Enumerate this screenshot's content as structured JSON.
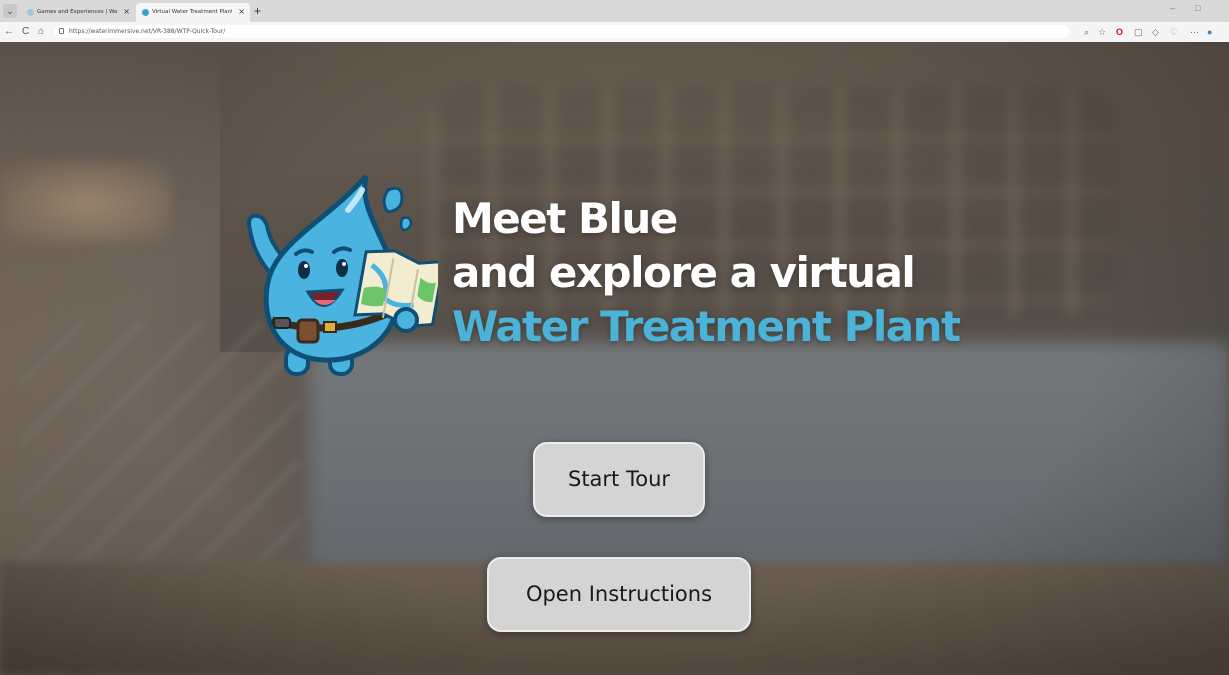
{
  "browser": {
    "tabs": [
      {
        "title": "Games and Experiences | WaterVi",
        "active": false
      },
      {
        "title": "Virtual Water Treatment Plant",
        "active": true
      }
    ],
    "new_tab": "+",
    "close_glyph": "×",
    "url": "https://waterimmersive.net/VR-388/WTP-Quick-Tour/",
    "nav": {
      "back": "←",
      "forward": "→",
      "reload": "C",
      "home": "⌂"
    },
    "extensions": [
      "search-icon",
      "star-icon",
      "opera-icon",
      "extension-icon",
      "shield-icon",
      "heart-icon",
      "menu-dots-icon",
      "profile-icon"
    ]
  },
  "hero": {
    "line1": "Meet Blue",
    "line2": "and explore a virtual",
    "line3": "Water Treatment Plant",
    "accent_color": "#4bb3d8"
  },
  "buttons": {
    "start_tour": "Start Tour",
    "open_instructions": "Open Instructions"
  }
}
